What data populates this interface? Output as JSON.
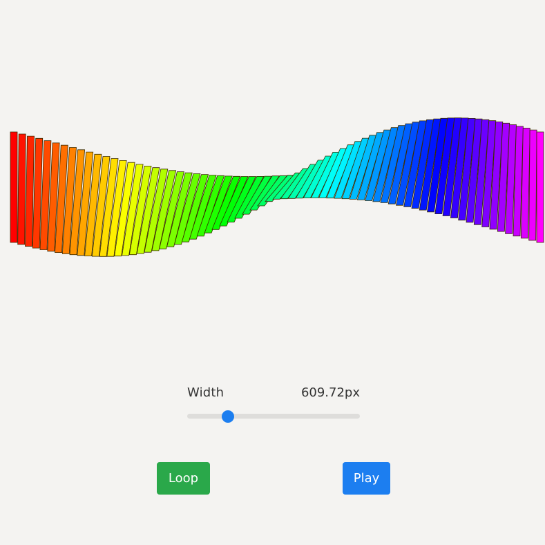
{
  "controls": {
    "width_label": "Width",
    "width_value": "609.72px",
    "width_slider_fraction": 0.22,
    "loop_label": "Loop",
    "play_label": "Play"
  },
  "colors": {
    "background": "#f4f3f1",
    "loop_button": "#2aa84a",
    "play_button": "#1c7ef0",
    "slider_thumb": "#1c7ef0",
    "slider_track": "#dedddb",
    "ribbon_outline": "#3a2a00"
  }
}
